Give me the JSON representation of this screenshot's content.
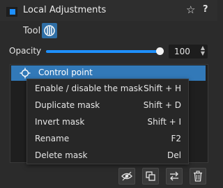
{
  "panel": {
    "title": "Local Adjustments",
    "accent_color": "#1e90ff",
    "header_icons": [
      "star-icon",
      "help-icon"
    ],
    "star_glyph": "☆",
    "help_glyph": "?"
  },
  "tool": {
    "label": "Tool",
    "icon": "control-point-tool-icon"
  },
  "opacity": {
    "label": "Opacity",
    "value": "100",
    "level_percent": 100
  },
  "mask_list": {
    "items": [
      {
        "name": "Control point",
        "icon": "control-point-icon",
        "selected": true
      }
    ]
  },
  "context_menu": {
    "items": [
      {
        "label": "Enable / disable the mask",
        "shortcut": "Shift + H"
      },
      {
        "label": "Duplicate mask",
        "shortcut": "Shift + D"
      },
      {
        "label": "Invert mask",
        "shortcut": "Shift + I"
      },
      {
        "label": "Rename",
        "shortcut": "F2"
      },
      {
        "label": "Delete mask",
        "shortcut": "Del"
      }
    ]
  },
  "toolbar": {
    "buttons": [
      "eye-icon",
      "duplicate-icon",
      "swap-icon",
      "trash-icon"
    ]
  }
}
